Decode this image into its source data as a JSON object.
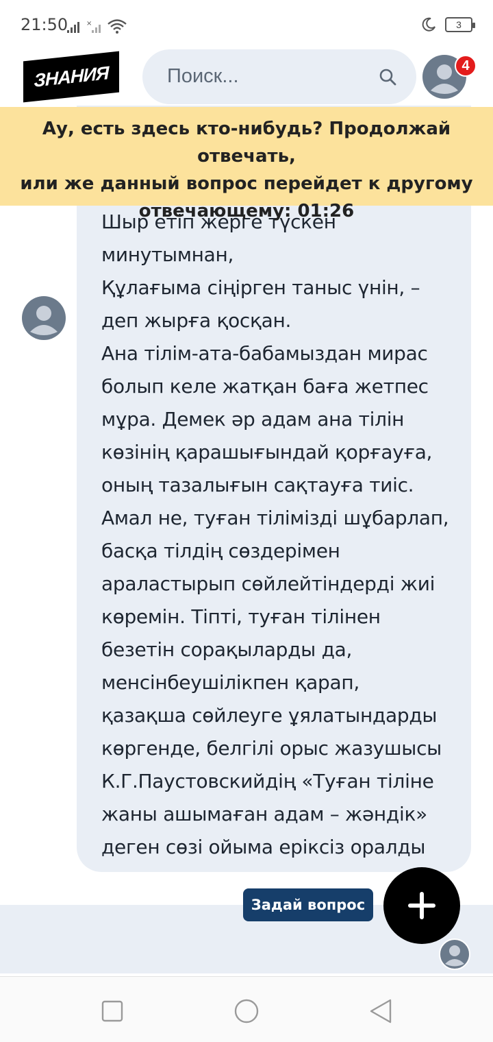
{
  "status_bar": {
    "time": "21:50",
    "battery": "3"
  },
  "header": {
    "logo_text": "ЗНАНИЯ",
    "search_placeholder": "Поиск...",
    "notification_count": "4"
  },
  "banner": {
    "lines": [
      "Ау, есть здесь кто-нибудь? Продолжай отвечать,",
      "или же данный вопрос перейдет к другому",
      "отвечающему: 01:26"
    ]
  },
  "answer": {
    "lines": [
      "Шыр етіп жерге түскен",
      "минутымнан,",
      "Құлағыма сіңірген таныс үнін, –",
      "деп жырға қосқан.",
      "Ана тілім-ата-бабамыздан мирас",
      "болып келе жатқан баға жетпес",
      "мұра. Демек әр адам ана тілін",
      "көзінің қарашығындай қорғауға,",
      "оның тазалығын сақтауға тиіс.",
      "Амал не, туған тілімізді шұбарлап,",
      "басқа тілдің сөздерімен",
      "араластырып сөйлейтіндерді жиі",
      "көремін. Тіпті, туған тілінен",
      "безетін сорақыларды да,",
      "менсінбеушілікпен қарап,",
      "қазақша сөйлеуге ұялатындарды",
      "көргенде, белгілі орыс жазушысы",
      "К.Г.Паустовскийдің «Туған тіліне",
      "жаны ашымаған адам – жәндік»",
      "деген сөзі ойыма еріксіз оралды"
    ]
  },
  "actions": {
    "ask_label": "Задай вопрос"
  },
  "colors": {
    "banner": "#fce29c",
    "bubble": "#e9eef5",
    "ask_button": "#163e6a",
    "badge": "#e31c1c"
  },
  "icons": [
    "signal-icon",
    "wifi-icon",
    "moon-icon",
    "battery-icon",
    "search-icon",
    "avatar-icon",
    "plus-icon",
    "nav-square-icon",
    "nav-circle-icon",
    "nav-back-icon"
  ]
}
